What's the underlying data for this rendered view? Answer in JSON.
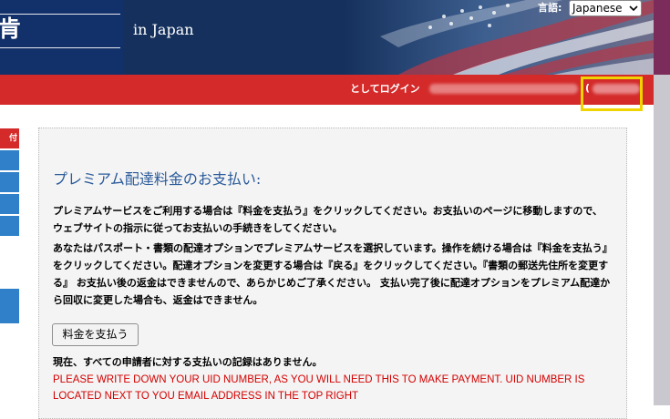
{
  "header": {
    "title_fragment": "肯",
    "location": "in Japan",
    "language_label": "言語:",
    "language_selected": "Japanese"
  },
  "login_bar": {
    "login_as": "としてログイン",
    "uid_paren": "("
  },
  "nav": {
    "active_fragment": "付"
  },
  "main": {
    "title": "プレミアム配達料金のお支払い:",
    "paragraph1": "プレミアムサービスをご利用する場合は『料金を支払う』をクリックしてください。お支払いのページに移動しますので、ウェブサイトの指示に従ってお支払いの手続きをしてください。",
    "paragraph2": "あなたはパスポート・書類の配達オプションでプレミアムサービスを選択しています。操作を続ける場合は『料金を支払う』をクリックしてください。配達オプションを変更する場合は『戻る』をクリックしてください。『書類の郵送先住所を変更する』 お支払い後の返金はできませんので、あらかじめご了承ください。 支払い完了後に配達オプションをプレミアム配達から回収に変更した場合も、返金はできません。",
    "pay_button": "料金を支払う",
    "status": "現在、すべての申請者に対する支払いの記録はありません。",
    "warning": "PLEASE WRITE DOWN YOUR UID NUMBER, AS YOU WILL NEED THIS TO MAKE PAYMENT. UID NUMBER IS LOCATED NEXT TO YOU EMAIL ADDRESS IN THE TOP RIGHT"
  },
  "colors": {
    "header_navy": "#15305c",
    "red_bar": "#d42a2a",
    "nav_blue": "#2f80c8",
    "title_blue": "#2a5a9a",
    "warning_red": "#d40000",
    "highlight_yellow": "#f0d400"
  }
}
